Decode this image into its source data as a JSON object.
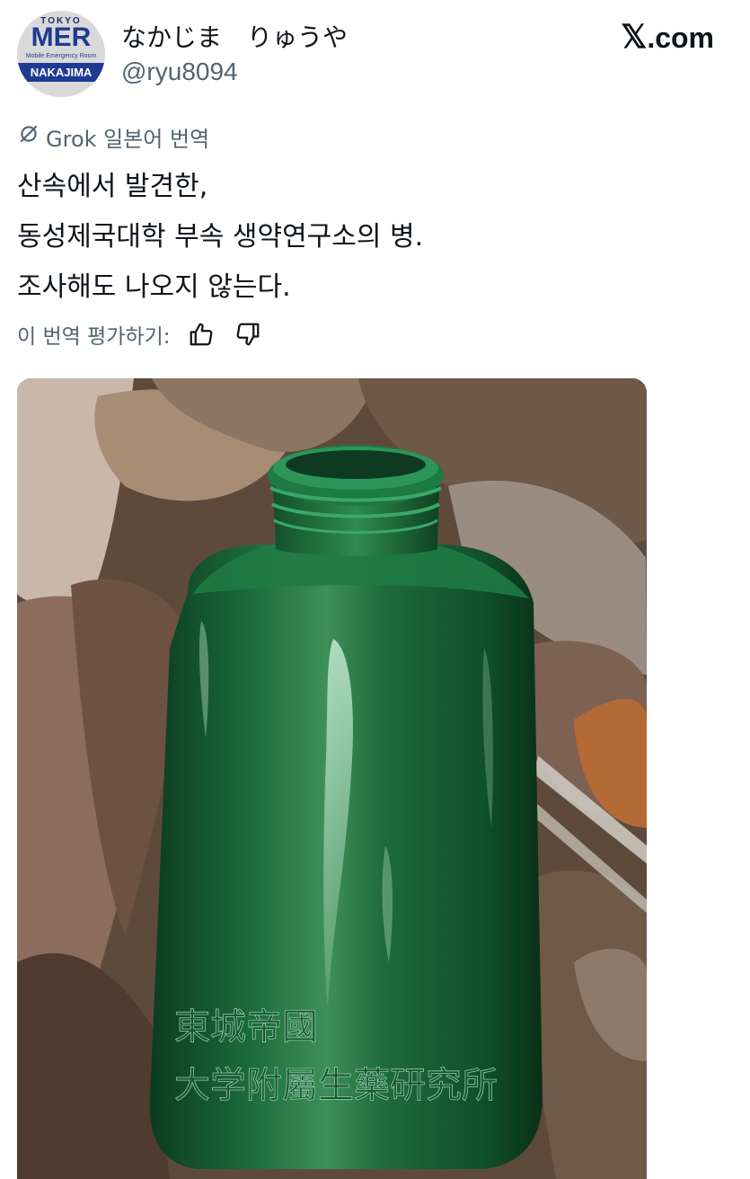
{
  "post": {
    "display_name": "なかじま　りゅうや",
    "handle": "@ryu8094",
    "source_site": ".com",
    "avatar": {
      "top_text": "TOKYO",
      "main_text": "MER",
      "sub_text": "Mobile Emergency Room",
      "band_text": "NAKAJIMA"
    },
    "translation_label": "Grok 일본어 번역",
    "text_lines": [
      "산속에서 발견한,",
      "동성제국대학 부속 생약연구소의 병.",
      "조사해도 나오지 않는다."
    ],
    "rate_prompt": "이 번역 평가하기:",
    "icons": {
      "grok": "grok-icon",
      "thumbs_up": "thumbs-up-icon",
      "thumbs_down": "thumbs-down-icon",
      "x_logo": "x-logo-icon"
    },
    "photo": {
      "subject": "green glass bottle on dead leaves",
      "embossed_text_line1": "東城帝國",
      "embossed_text_line2": "大学附屬生藥研究所"
    }
  },
  "colors": {
    "text_primary": "#0f1419",
    "text_secondary": "#536471",
    "bottle_green": "#1f6b3a",
    "leaf_brown": "#7a5a44"
  }
}
